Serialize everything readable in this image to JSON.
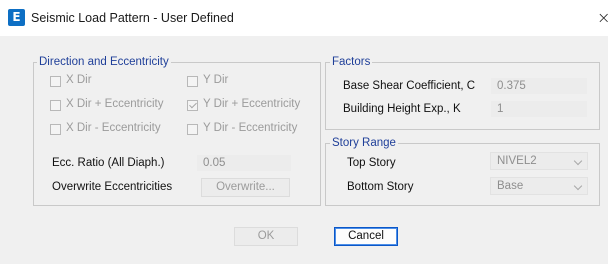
{
  "window": {
    "app_icon": "E",
    "title": "Seismic Load Pattern - User Defined",
    "close_glyph": "×"
  },
  "direction": {
    "group_title": "Direction and Eccentricity",
    "options": [
      {
        "label": "X Dir",
        "checked": false
      },
      {
        "label": "Y Dir",
        "checked": false
      },
      {
        "label": "X Dir + Eccentricity",
        "checked": false
      },
      {
        "label": "Y Dir + Eccentricity",
        "checked": true
      },
      {
        "label": "X Dir - Eccentricity",
        "checked": false
      },
      {
        "label": "Y Dir - Eccentricity",
        "checked": false
      }
    ],
    "ecc_label": "Ecc. Ratio (All Diaph.)",
    "ecc_value": "0.05",
    "overwrite_label": "Overwrite Eccentricities",
    "overwrite_button": "Overwrite..."
  },
  "factors": {
    "group_title": "Factors",
    "base_shear_label": "Base Shear Coefficient, C",
    "base_shear_value": "0.375",
    "height_exp_label": "Building Height Exp., K",
    "height_exp_value": "1"
  },
  "story_range": {
    "group_title": "Story Range",
    "top_label": "Top Story",
    "top_value": "NIVEL2",
    "bottom_label": "Bottom Story",
    "bottom_value": "Base"
  },
  "buttons": {
    "ok": "OK",
    "cancel": "Cancel"
  }
}
